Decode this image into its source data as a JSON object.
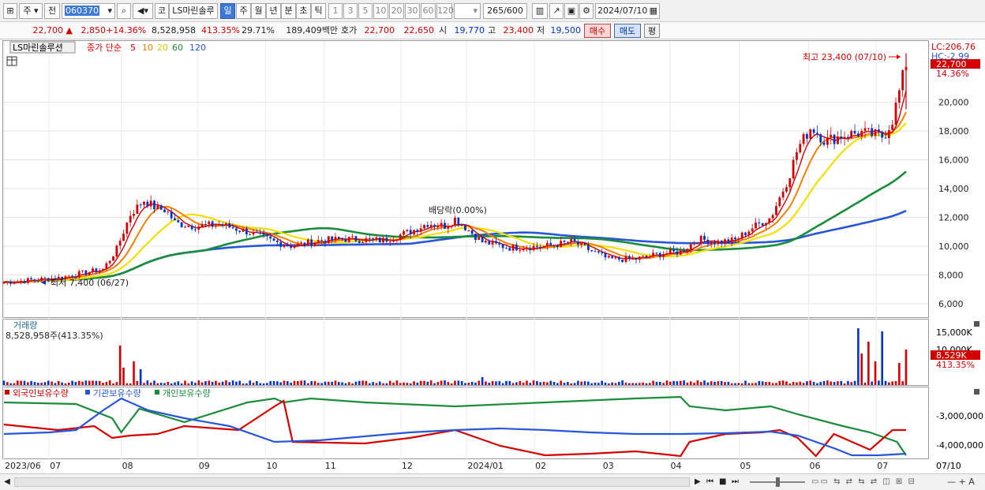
{
  "toolbar": {
    "market": "주",
    "prev": "전",
    "code": "060370",
    "co_btn": "코",
    "name": "LS마린솔루",
    "periods": [
      "일",
      "주",
      "월",
      "년",
      "분",
      "초",
      "틱"
    ],
    "selected_period": "일",
    "intervals": [
      "1",
      "3",
      "5",
      "10",
      "20",
      "30",
      "60",
      "120"
    ],
    "count": "265",
    "count_total": "/600",
    "date": "2024/07/10"
  },
  "quote": {
    "price": "22,700",
    "arrow": "▲",
    "change": "2,850",
    "change_pct": "+14.36%",
    "volume": "8,528,958",
    "volume_pct": "413.35%",
    "turnover": "29.71%",
    "amount": "189,409백만",
    "bid_label": "호가",
    "ask": "22,700",
    "bid": "22,650",
    "open_label": "시",
    "open": "19,770",
    "high_label": "고",
    "high": "23,400",
    "low_label": "저",
    "low": "19,500",
    "buy_btn": "매수",
    "sell_btn": "매도",
    "avg_btn": "평"
  },
  "price_panel": {
    "stock_label": "LS마린솔루션",
    "legend_title": "종가 단순",
    "ma_periods": [
      "5",
      "10",
      "20",
      "60",
      "120"
    ],
    "ma_colors": [
      "#d40000",
      "#f08000",
      "#f0e000",
      "#1a8c3c",
      "#2856d8"
    ],
    "lc_label": "LC:206.76",
    "hc_label": "HC:-2.99",
    "last_price_tag": "22,700",
    "last_pct_tag": "14.36%",
    "high_annotation": "최고 23,400 (07/10)",
    "low_annotation": "최저 7,400 (06/27)",
    "dividend_annotation": "배당락(0.00%)",
    "y_ticks": [
      "20,000",
      "18,000",
      "16,000",
      "14,000",
      "12,000",
      "10,000",
      "8,000",
      "6,000"
    ]
  },
  "volume_panel": {
    "title": "거래량",
    "value": "8,528,958주(413.35%)",
    "y_ticks": [
      "15,000K",
      "10,000K"
    ],
    "last_tag": "8,529K",
    "last_pct": "413.35%"
  },
  "holdings_panel": {
    "legend": [
      "외국인보유수량",
      "기관보유수량",
      "개인보유수량"
    ],
    "legend_colors": [
      "#d40000",
      "#2856d8",
      "#1a8c3c"
    ],
    "y_ticks": [
      "-3,000,000",
      "-4,000,000"
    ]
  },
  "x_axis": {
    "labels": [
      "2023/06",
      "07",
      "08",
      "09",
      "10",
      "11",
      "12",
      "2024/01",
      "02",
      "03",
      "04",
      "05",
      "06",
      "07"
    ],
    "end_label": "07/10"
  },
  "colors": {
    "up": "#d40000",
    "down": "#0033cc",
    "accent": "#3b78d8"
  }
}
